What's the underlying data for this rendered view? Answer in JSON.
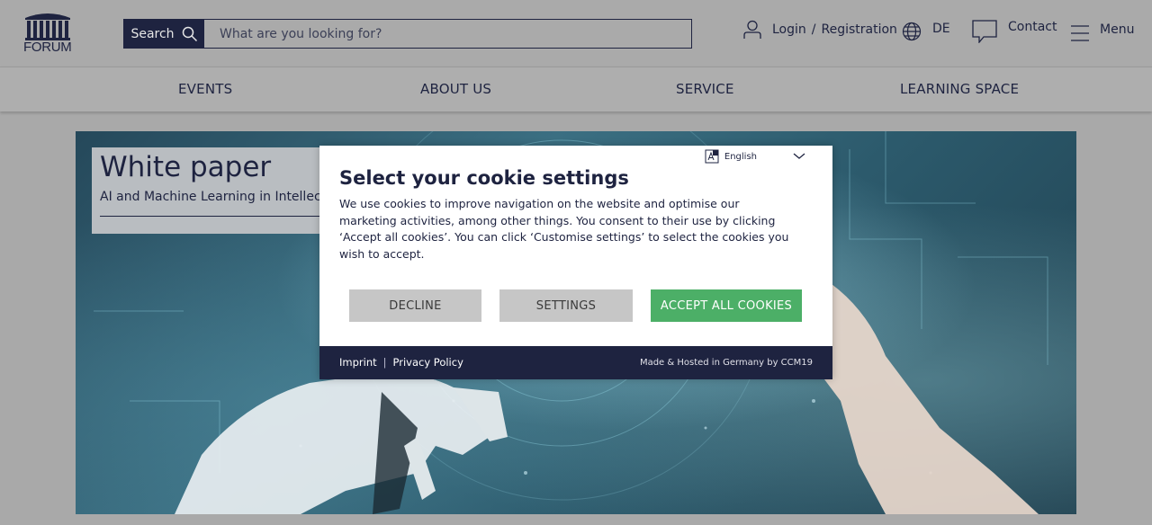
{
  "header": {
    "logo_text": "FORUM",
    "search": {
      "button_label": "Search",
      "placeholder": "What are you looking for?",
      "value": ""
    },
    "login_label": "Login",
    "login_separator": "/",
    "registration_label": "Registration",
    "language_label": "DE",
    "contact_label": "Contact",
    "menu_label": "Menu"
  },
  "nav": {
    "items": [
      {
        "label": "EVENTS"
      },
      {
        "label": "ABOUT US"
      },
      {
        "label": "SERVICE"
      },
      {
        "label": "LEARNING SPACE"
      }
    ]
  },
  "hero": {
    "title": "White paper",
    "subtitle": "AI and Machine Learning in Intellectual Property"
  },
  "cookie_modal": {
    "language": "English",
    "title": "Select your cookie settings",
    "body": "We use cookies to improve navigation on the website and optimise our marketing activities, among other things. You consent to their use by clicking ‘Accept all cookies’. You can click ‘Customise settings’ to select the cookies you wish to accept.",
    "decline_label": "DECLINE",
    "settings_label": "SETTINGS",
    "accept_label": "ACCEPT ALL COOKIES",
    "footer": {
      "imprint_label": "Imprint",
      "separator": "|",
      "privacy_label": "Privacy Policy",
      "credit": "Made & Hosted in Germany by CCM19"
    }
  },
  "colors": {
    "navy": "#1e2340",
    "accept_green": "#4caf67",
    "page_bg": "#aaaaaa"
  }
}
